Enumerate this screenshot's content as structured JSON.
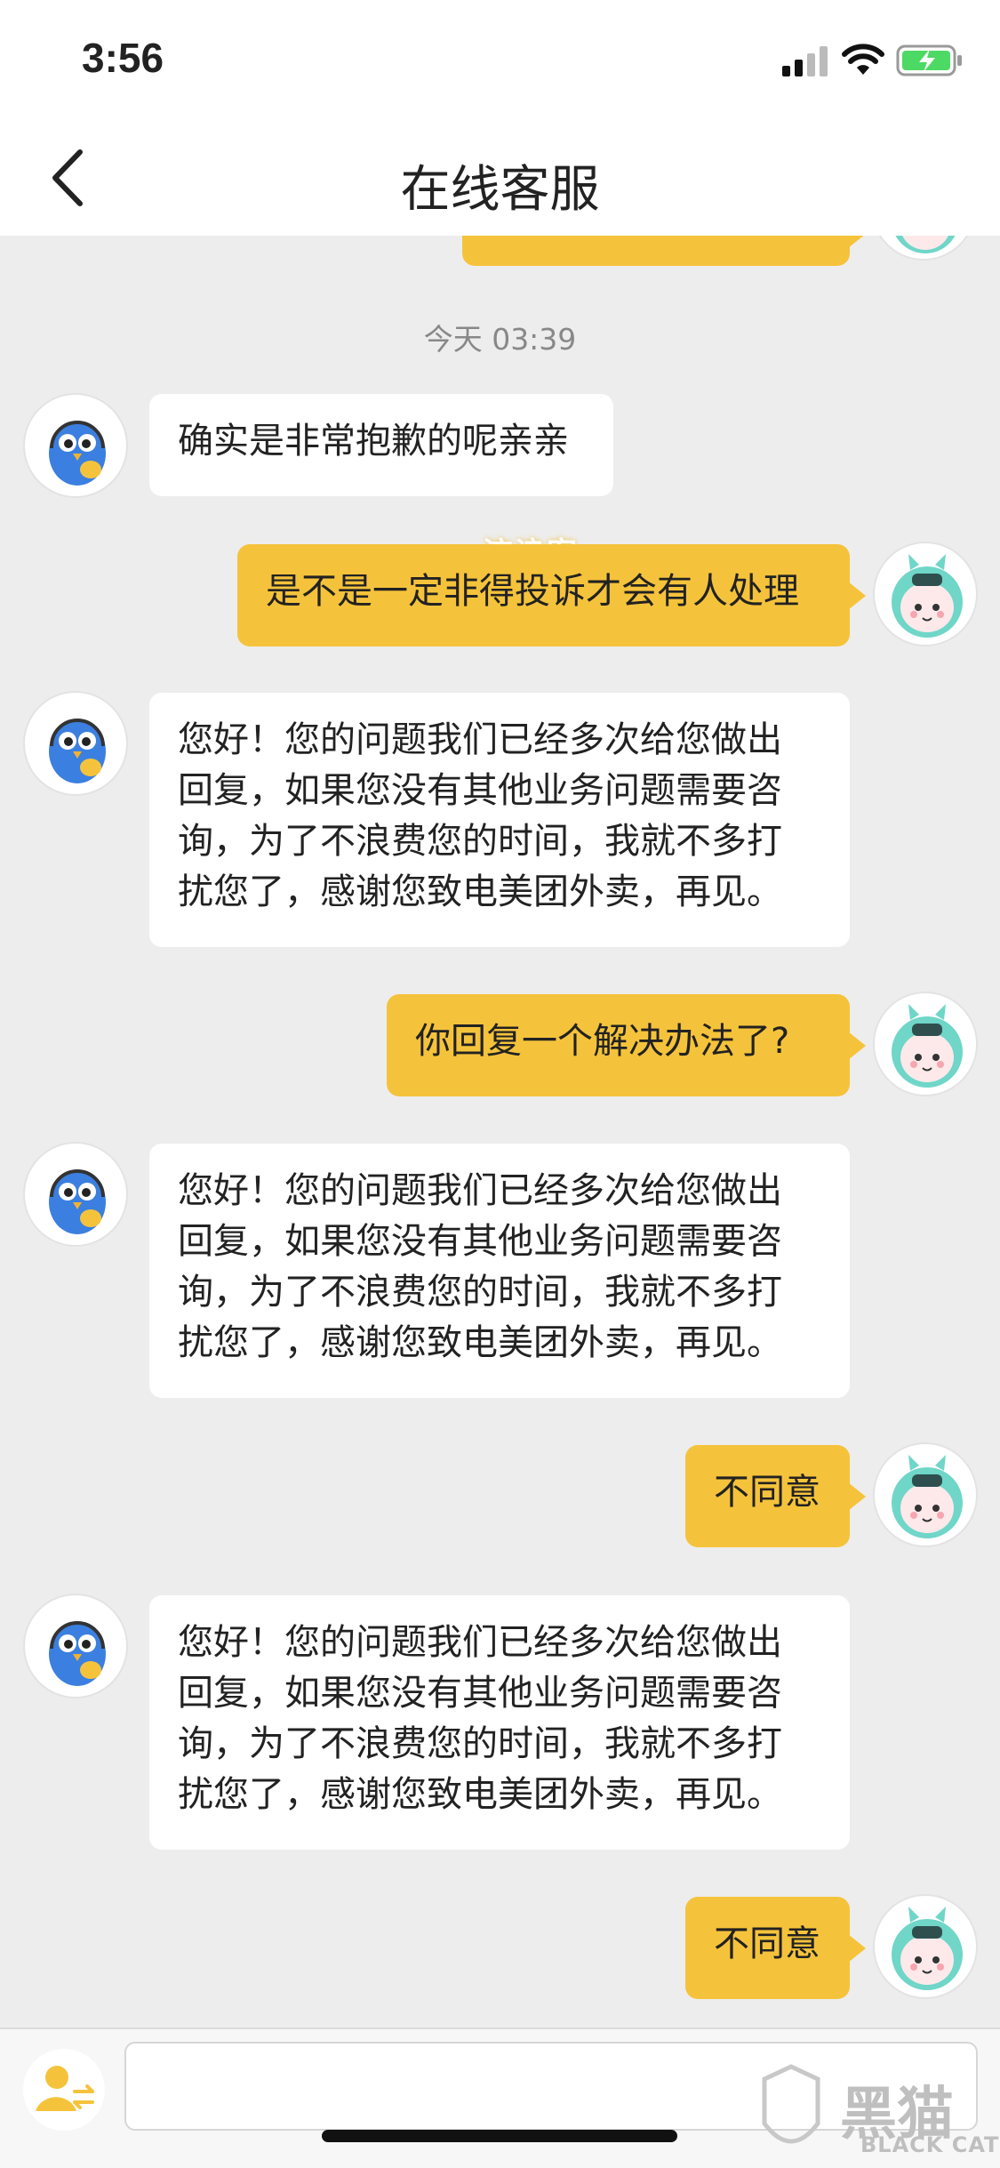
{
  "status_bar": {
    "time": "3:56"
  },
  "header": {
    "title": "在线客服"
  },
  "chat": {
    "timestamp": "今天 03:39",
    "watermark": "流浪客",
    "messages": [
      {
        "side": "left",
        "text": "确实是非常抱歉的呢亲亲"
      },
      {
        "side": "right",
        "text": "是不是一定非得投诉才会有人处理"
      },
      {
        "side": "left",
        "text": "您好！您的问题我们已经多次给您做出\n回复，如果您没有其他业务问题需要咨\n询，为了不浪费您的时间，我就不多打\n扰您了，感谢您致电美团外卖，再见。"
      },
      {
        "side": "right",
        "text": "你回复一个解决办法了?"
      },
      {
        "side": "left",
        "text": "您好！您的问题我们已经多次给您做出\n回复，如果您没有其他业务问题需要咨\n询，为了不浪费您的时间，我就不多打\n扰您了，感谢您致电美团外卖，再见。"
      },
      {
        "side": "right",
        "text": "不同意"
      },
      {
        "side": "left",
        "text": "您好！您的问题我们已经多次给您做出\n回复，如果您没有其他业务问题需要咨\n询，为了不浪费您的时间，我就不多打\n扰您了，感谢您致电美团外卖，再见。"
      },
      {
        "side": "right",
        "text": "不同意"
      }
    ]
  },
  "input": {
    "placeholder": ""
  },
  "brand_watermark": {
    "cn": "黑猫",
    "en": "BLACK CAT"
  },
  "colors": {
    "user_bubble": "#f5c33b",
    "agent_bubble": "#ffffff",
    "background": "#ededed"
  },
  "icons": [
    "back-arrow-icon",
    "signal-icon",
    "wifi-icon",
    "battery-icon",
    "agent-bird-avatar",
    "user-robot-avatar",
    "transfer-human-icon"
  ]
}
